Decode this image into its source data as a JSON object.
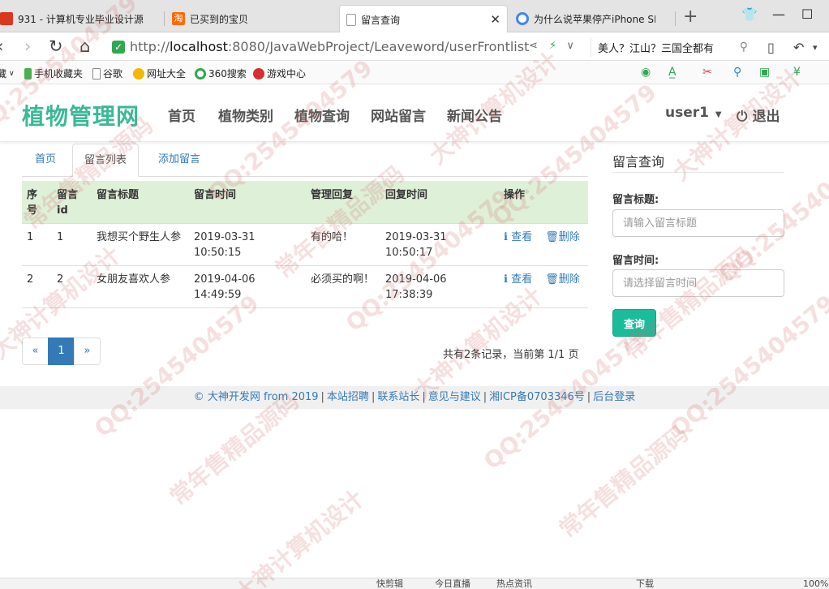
{
  "browser": {
    "tabs": [
      {
        "title": "931 - 计算机专业毕业设计源",
        "active": false
      },
      {
        "title": "已买到的宝贝",
        "active": false
      },
      {
        "title": "留言查询",
        "active": true
      },
      {
        "title": "为什么说苹果停产iPhone SE",
        "active": false
      }
    ],
    "new_tab": "+",
    "url": {
      "protocol": "http://",
      "host": "localhost",
      "path": ":8080/JavaWebProject/Leaveword/userFrontlist"
    },
    "search_text": "美人？江山？三国全都有",
    "bookmarks": [
      {
        "label": "藏",
        "icon_color": "#999999"
      },
      {
        "label": "手机收藏夹",
        "icon_color": "#4caf50"
      },
      {
        "label": "谷歌",
        "icon_color": "#9e9e9e"
      },
      {
        "label": "网址大全",
        "icon_color": "#f5b800"
      },
      {
        "label": "360搜索",
        "icon_color": "#2fa84f"
      },
      {
        "label": "游戏中心",
        "icon_color": "#d63031"
      }
    ]
  },
  "site": {
    "brand": "植物管理网",
    "brand_color": "#3bb897",
    "nav": [
      "首页",
      "植物类别",
      "植物查询",
      "网站留言",
      "新闻公告"
    ],
    "user": "user1",
    "logout": "退出"
  },
  "content_tabs": [
    {
      "label": "首页",
      "active": false
    },
    {
      "label": "留言列表",
      "active": true
    },
    {
      "label": "添加留言",
      "active": false
    }
  ],
  "table": {
    "headers": [
      "序号",
      "留言id",
      "留言标题",
      "留言时间",
      "管理回复",
      "回复时间",
      "操作"
    ],
    "header_bg": "#dff0d8",
    "rows": [
      {
        "no": "1",
        "id": "1",
        "title": "我想买个野生人参",
        "time": "2019-03-31 10:50:15",
        "reply": "有的哈！",
        "reply_time": "2019-03-31 10:50:17"
      },
      {
        "no": "2",
        "id": "2",
        "title": "女朋友喜欢人参",
        "time": "2019-04-06 14:49:59",
        "reply": "必须买的啊！",
        "reply_time": "2019-04-06 17:38:39"
      }
    ],
    "actions": {
      "view": "查看",
      "delete": "删除"
    }
  },
  "pagination": {
    "prev": "«",
    "current": "1",
    "next": "»",
    "info": "共有2条记录，当前第 1/1 页"
  },
  "sidebar": {
    "title": "留言查询",
    "title_label": "留言标题:",
    "title_placeholder": "请输入留言标题",
    "time_label": "留言时间:",
    "time_placeholder": "请选择留言时间",
    "query_button": "查询",
    "button_color": "#1abc9c"
  },
  "footer": {
    "copyright": "© 大神开发网 from 2019",
    "links": [
      "本站招聘",
      "联系站长",
      "意见与建议",
      "湘ICP备0703346号",
      "后台登录"
    ]
  },
  "statusbar": {
    "items": [
      "快剪辑",
      "今日直播",
      "热点资讯",
      "下载",
      "100%"
    ]
  },
  "watermark": {
    "texts": [
      "QQ:2545404579",
      "常年售精品源码",
      "大神计算机设计"
    ]
  }
}
